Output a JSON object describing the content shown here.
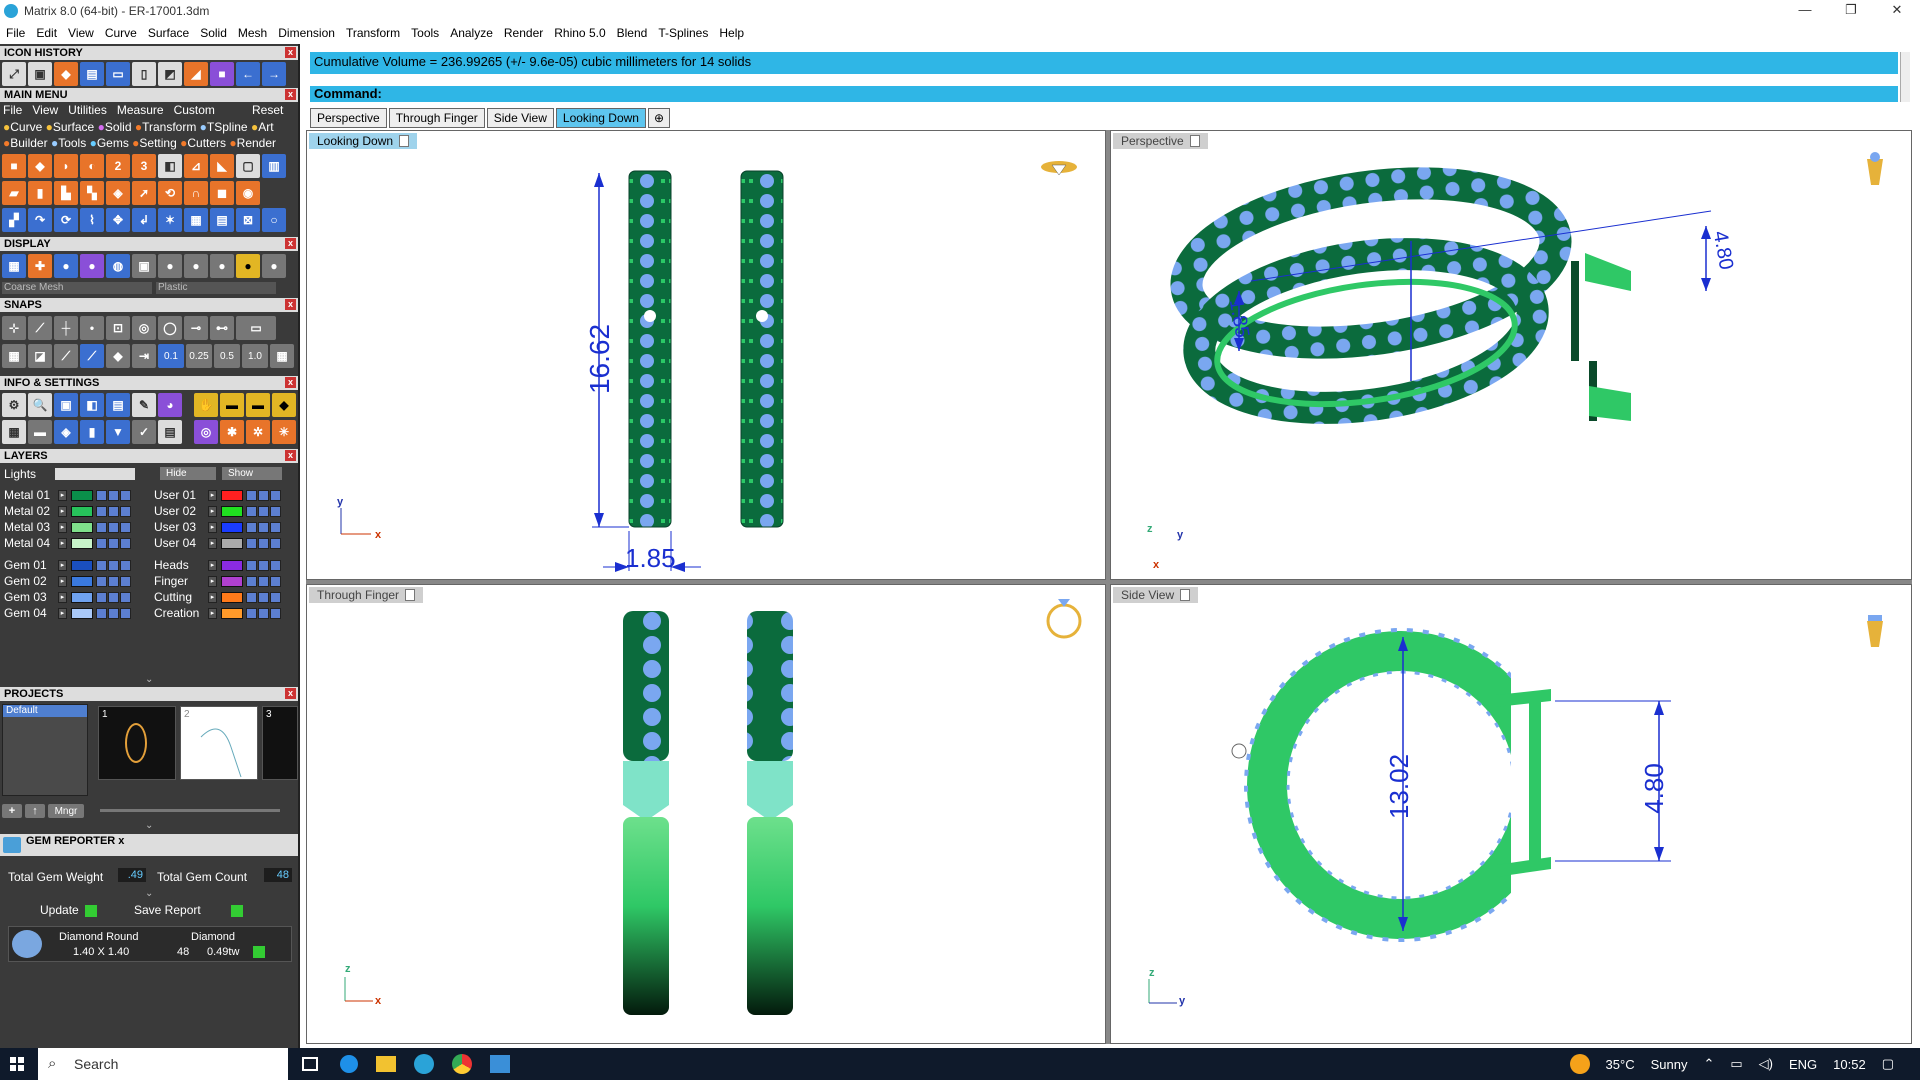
{
  "window": {
    "title": "Matrix 8.0 (64-bit) - ER-17001.3dm"
  },
  "menu": [
    "File",
    "Edit",
    "View",
    "Curve",
    "Surface",
    "Solid",
    "Mesh",
    "Dimension",
    "Transform",
    "Tools",
    "Analyze",
    "Render",
    "Rhino 5.0",
    "Blend",
    "T-Splines",
    "Help"
  ],
  "panel": {
    "icon_history": "ICON HISTORY",
    "main_menu": "MAIN MENU",
    "main_menu_items": [
      "File",
      "View",
      "Utilities",
      "Measure",
      "Custom"
    ],
    "reset": "Reset",
    "sub_menu_row1": [
      "Curve",
      "Surface",
      "Solid",
      "Transform",
      "TSpline",
      "Art"
    ],
    "sub_menu_row2": [
      "Builder",
      "Tools",
      "Gems",
      "Setting",
      "Cutters",
      "Render"
    ],
    "display": "DISPLAY",
    "display_mesh": "Coarse Mesh",
    "display_material": "Plastic",
    "snaps": "SNAPS",
    "snap_values": [
      "0.1",
      "0.25",
      "0.5",
      "1.0"
    ],
    "info_settings": "INFO & SETTINGS",
    "layers": "LAYERS",
    "lights": "Lights",
    "hide": "Hide",
    "show": "Show",
    "layers_left": [
      {
        "name": "Metal 01",
        "color": "#0a8f4a"
      },
      {
        "name": "Metal 02",
        "color": "#27c25b"
      },
      {
        "name": "Metal 03",
        "color": "#7fe08b"
      },
      {
        "name": "Metal 04",
        "color": "#c7f3c9"
      },
      {
        "name": "Gem 01",
        "color": "#1a4fbf"
      },
      {
        "name": "Gem 02",
        "color": "#3a79de"
      },
      {
        "name": "Gem 03",
        "color": "#6fa2ef"
      },
      {
        "name": "Gem 04",
        "color": "#a9c8f7"
      }
    ],
    "layers_right": [
      {
        "name": "User 01",
        "color": "#ff2020"
      },
      {
        "name": "User 02",
        "color": "#20e020"
      },
      {
        "name": "User 03",
        "color": "#1a3cff"
      },
      {
        "name": "User 04",
        "color": "#aaaaaa"
      },
      {
        "name": "Heads",
        "color": "#8a2be2"
      },
      {
        "name": "Finger",
        "color": "#b040d0"
      },
      {
        "name": "Cutting",
        "color": "#ff7a1a"
      },
      {
        "name": "Creation",
        "color": "#ff9a2a"
      }
    ],
    "projects": "PROJECTS",
    "project_default": "Default",
    "project_thumbs": [
      "1",
      "2",
      "3"
    ],
    "mngr": "Mngr",
    "gem_reporter": "GEM REPORTER",
    "total_gem_weight_label": "Total Gem Weight",
    "total_gem_weight": ".49",
    "total_gem_count_label": "Total Gem Count",
    "total_gem_count": "48",
    "update": "Update",
    "save_report": "Save Report",
    "gem_row": {
      "cut": "Diamond Round",
      "type": "Diamond",
      "size": "1.40 X 1.40",
      "count": "48",
      "weight": "0.49tw"
    }
  },
  "command": {
    "output": "Cumulative Volume = 236.99265 (+/- 9.6e-05) cubic millimeters for 14 solids",
    "prompt": "Command:"
  },
  "tabs": [
    "Perspective",
    "Through Finger",
    "Side View",
    "Looking Down"
  ],
  "viewports": {
    "top_left": {
      "label": "Looking Down",
      "dims": [
        "16.62",
        "1.85"
      ]
    },
    "top_right": {
      "label": "Perspective",
      "dims": [
        "4.80",
        "1.85"
      ]
    },
    "bottom_left": {
      "label": "Through Finger"
    },
    "bottom_right": {
      "label": "Side View",
      "dims": [
        "13.02",
        "4.80"
      ]
    }
  },
  "axes": {
    "x": "x",
    "y": "y",
    "z": "z"
  },
  "taskbar": {
    "search": "Search",
    "weather_temp": "35°C",
    "weather_desc": "Sunny",
    "lang": "ENG",
    "time": "10:52"
  },
  "colors": {
    "accent": "#2fb6e6",
    "metal_dark": "#0a6e3e",
    "metal_light": "#4fd17a",
    "gem": "#7aa7f0",
    "dimension": "#1a2fd0"
  }
}
